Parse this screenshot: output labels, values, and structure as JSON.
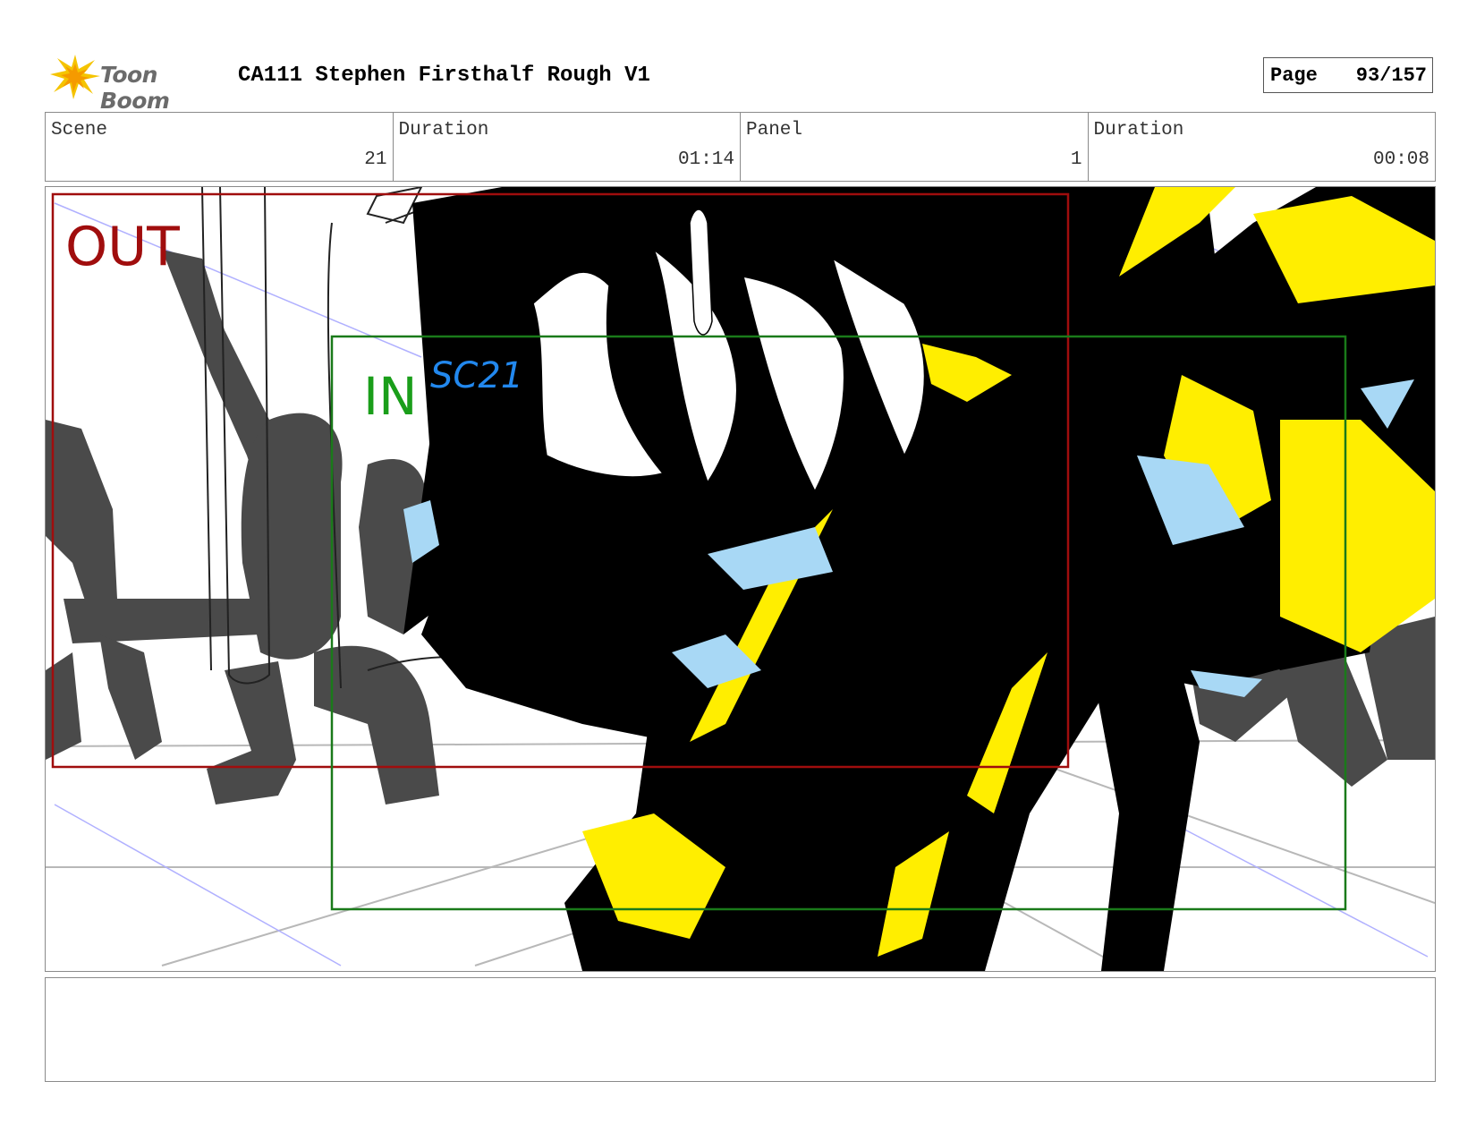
{
  "header": {
    "logo_text": "Toon Boom",
    "title": "CA111 Stephen Firsthalf Rough V1",
    "page_label": "Page",
    "page_value": "93/157"
  },
  "info": {
    "scene_label": "Scene",
    "scene_value": "21",
    "scene_duration_label": "Duration",
    "scene_duration_value": "01:14",
    "panel_label": "Panel",
    "panel_value": "1",
    "panel_duration_label": "Duration",
    "panel_duration_value": "00:08"
  },
  "panel": {
    "out_label": "OUT",
    "in_label": "IN",
    "scene_note": "SC21"
  },
  "colors": {
    "out_frame": "#a00d0d",
    "in_frame": "#1a7a1a",
    "in_text": "#1a9e1a",
    "note_text": "#2288ee",
    "sketch_yellow": "#ffee00",
    "sketch_blue": "#a8d8f5",
    "sketch_grey": "#4a4a4a"
  },
  "notes": {
    "text": ""
  }
}
